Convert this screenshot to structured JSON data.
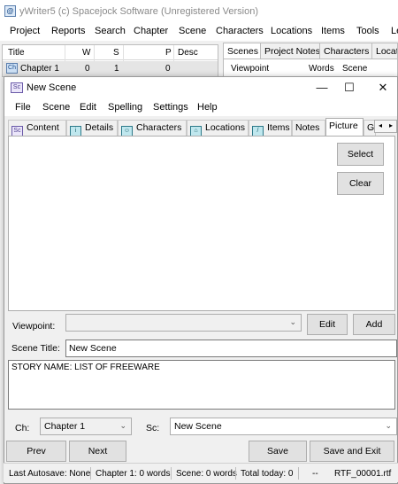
{
  "app": {
    "title": "yWriter5 (c) Spacejock Software (Unregistered Version)",
    "icon": "app-logo-icon"
  },
  "main_menu": [
    "Project",
    "Reports",
    "Search",
    "Chapter",
    "Scene",
    "Characters",
    "Locations",
    "Items",
    "Tools",
    "Le"
  ],
  "chapter_grid": {
    "headers": [
      "Title",
      "W",
      "S",
      "P",
      "Desc"
    ],
    "rows": [
      {
        "badge": "Ch",
        "title": "Chapter 1",
        "w": "0",
        "s": "1",
        "p": "0",
        "desc": ""
      }
    ]
  },
  "right_tabs": [
    "Scenes",
    "Project Notes",
    "Characters",
    "Locati"
  ],
  "right_panel": {
    "headers": [
      "Viewpoint",
      "Words",
      "Scene"
    ]
  },
  "dialog": {
    "icon_text": "Sc",
    "title": "New Scene",
    "window_buttons": {
      "minimize": "—",
      "maximize": "☐",
      "close": "✕"
    },
    "menu": [
      "File",
      "Scene",
      "Edit",
      "Spelling",
      "Settings",
      "Help"
    ],
    "tabs": [
      {
        "label": "Content",
        "icon": "Sc"
      },
      {
        "label": "Details",
        "icon": "i"
      },
      {
        "label": "Characters",
        "icon": "☺"
      },
      {
        "label": "Locations",
        "icon": "⌂"
      },
      {
        "label": "Items",
        "icon": "/"
      },
      {
        "label": "Notes",
        "icon": ""
      },
      {
        "label": "Picture",
        "icon": ""
      },
      {
        "label": "G",
        "icon": ""
      }
    ],
    "active_tab": "Picture",
    "tab_scroll": {
      "left": "◂",
      "right": "▸"
    },
    "picture_buttons": {
      "select": "Select",
      "clear": "Clear"
    },
    "viewpoint": {
      "label": "Viewpoint:",
      "value": "",
      "edit": "Edit",
      "add": "Add"
    },
    "scene_title": {
      "label": "Scene Title:",
      "value": "New Scene"
    },
    "story_text": "STORY NAME: LIST OF FREEWARE",
    "chapter_select": {
      "label": "Ch:",
      "value": "Chapter 1"
    },
    "scene_select": {
      "label": "Sc:",
      "value": "New Scene"
    },
    "nav": {
      "prev": "Prev",
      "next": "Next",
      "save": "Save",
      "save_exit": "Save and Exit"
    }
  },
  "status_bar": {
    "autosave": "Last Autosave: None",
    "chapter": "Chapter 1: 0 words",
    "scene": "Scene: 0 words",
    "today": "Total today: 0",
    "dash": "--",
    "file": "RTF_00001.rtf"
  }
}
